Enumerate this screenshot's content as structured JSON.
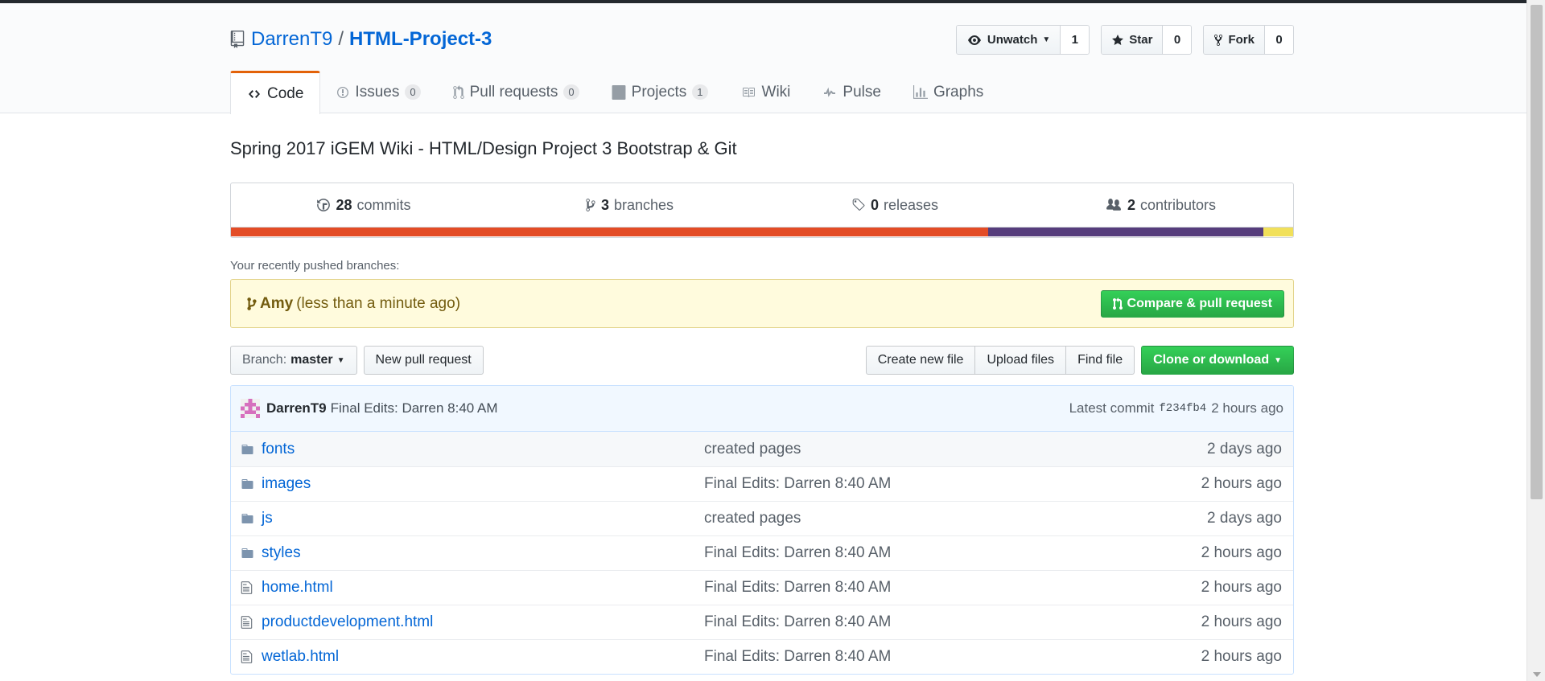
{
  "repo": {
    "owner": "DarrenT9",
    "separator": "/",
    "name": "HTML-Project-3"
  },
  "actions": {
    "watch": {
      "label": "Unwatch",
      "count": "1"
    },
    "star": {
      "label": "Star",
      "count": "0"
    },
    "fork": {
      "label": "Fork",
      "count": "0"
    }
  },
  "tabs": [
    {
      "label": "Code",
      "icon": "code-icon",
      "counter": ""
    },
    {
      "label": "Issues",
      "icon": "issue-icon",
      "counter": "0"
    },
    {
      "label": "Pull requests",
      "icon": "pull-request-icon",
      "counter": "0"
    },
    {
      "label": "Projects",
      "icon": "project-icon",
      "counter": "1"
    },
    {
      "label": "Wiki",
      "icon": "book-icon",
      "counter": ""
    },
    {
      "label": "Pulse",
      "icon": "pulse-icon",
      "counter": ""
    },
    {
      "label": "Graphs",
      "icon": "graph-icon",
      "counter": ""
    }
  ],
  "description": "Spring 2017 iGEM Wiki - HTML/Design Project 3 Bootstrap & Git",
  "summary": {
    "commits": {
      "num": "28",
      "label": "commits"
    },
    "branches": {
      "num": "3",
      "label": "branches"
    },
    "releases": {
      "num": "0",
      "label": "releases"
    },
    "contributors": {
      "num": "2",
      "label": "contributors"
    }
  },
  "languages": [
    {
      "color": "#e34c26",
      "share": 71.3
    },
    {
      "color": "#563d7c",
      "share": 25.9
    },
    {
      "color": "#f1e05a",
      "share": 2.8
    }
  ],
  "recent": {
    "label": "Your recently pushed branches:",
    "branch": "Amy",
    "time": "(less than a minute ago)",
    "button": "Compare & pull request"
  },
  "filebar": {
    "branch_prefix": "Branch:",
    "branch_name": "master",
    "new_pr": "New pull request",
    "create_file": "Create new file",
    "upload": "Upload files",
    "find": "Find file",
    "clone": "Clone or download"
  },
  "commit": {
    "author": "DarrenT9",
    "message": "Final Edits: Darren 8:40 AM",
    "latest_label": "Latest commit",
    "sha": "f234fb4",
    "age": "2 hours ago"
  },
  "files": [
    {
      "type": "folder",
      "name": "fonts",
      "message": "created pages",
      "age": "2 days ago"
    },
    {
      "type": "folder",
      "name": "images",
      "message": "Final Edits: Darren 8:40 AM",
      "age": "2 hours ago"
    },
    {
      "type": "folder",
      "name": "js",
      "message": "created pages",
      "age": "2 days ago"
    },
    {
      "type": "folder",
      "name": "styles",
      "message": "Final Edits: Darren 8:40 AM",
      "age": "2 hours ago"
    },
    {
      "type": "file",
      "name": "home.html",
      "message": "Final Edits: Darren 8:40 AM",
      "age": "2 hours ago"
    },
    {
      "type": "file",
      "name": "productdevelopment.html",
      "message": "Final Edits: Darren 8:40 AM",
      "age": "2 hours ago"
    },
    {
      "type": "file",
      "name": "wetlab.html",
      "message": "Final Edits: Darren 8:40 AM",
      "age": "2 hours ago"
    }
  ]
}
